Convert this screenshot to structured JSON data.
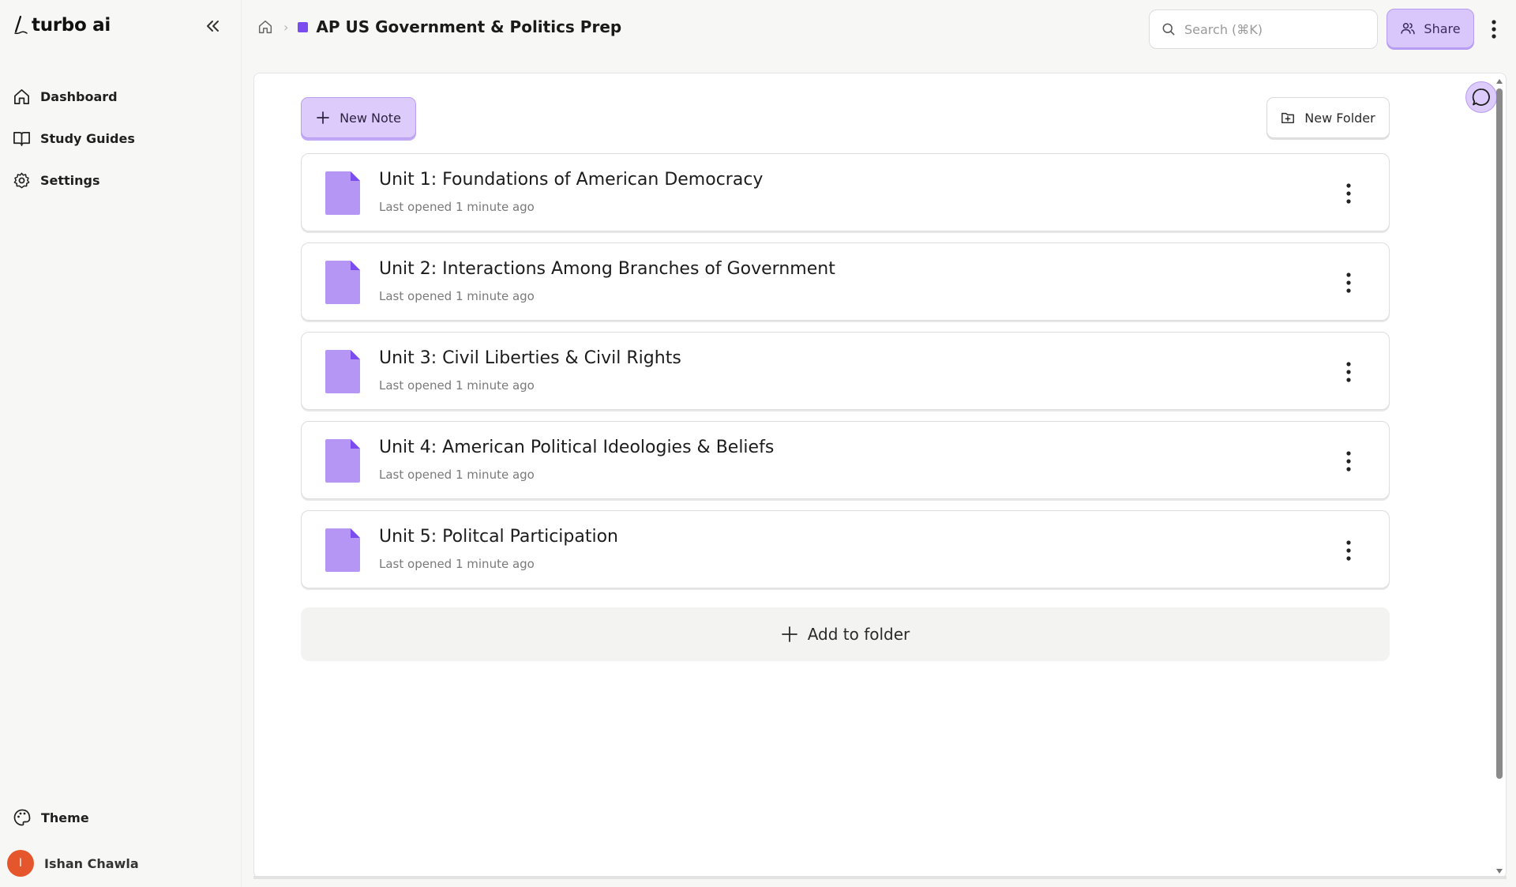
{
  "app": {
    "name": "turbo ai"
  },
  "sidebar": {
    "items": [
      {
        "label": "Dashboard",
        "icon": "home-icon"
      },
      {
        "label": "Study Guides",
        "icon": "book-icon"
      },
      {
        "label": "Settings",
        "icon": "gear-icon"
      }
    ],
    "theme_label": "Theme",
    "user": {
      "name": "Ishan Chawla",
      "initial": "I",
      "avatar_color": "#e6562c"
    }
  },
  "header": {
    "folder_title": "AP US Government & Politics Prep",
    "folder_color": "#7c4dee",
    "separator": "›",
    "search_placeholder": "Search (⌘K)",
    "share_label": "Share"
  },
  "toolbar": {
    "new_note_label": "New Note",
    "new_folder_label": "New Folder"
  },
  "notes": [
    {
      "title": "Unit 1: Foundations of American Democracy",
      "subtitle": "Last opened 1 minute ago"
    },
    {
      "title": "Unit 2: Interactions Among Branches of Government",
      "subtitle": "Last opened 1 minute ago"
    },
    {
      "title": "Unit 3: Civil Liberties & Civil Rights",
      "subtitle": "Last opened 1 minute ago"
    },
    {
      "title": "Unit 4: American Political Ideologies & Beliefs",
      "subtitle": "Last opened 1 minute ago"
    },
    {
      "title": "Unit 5: Politcal Participation",
      "subtitle": "Last opened 1 minute ago"
    }
  ],
  "add_to_folder_label": "Add to folder",
  "colors": {
    "accent": "#dccbfb",
    "accent_border": "#b99df2",
    "note_icon": "#b596f5",
    "note_icon_fold": "#7c4dee"
  }
}
